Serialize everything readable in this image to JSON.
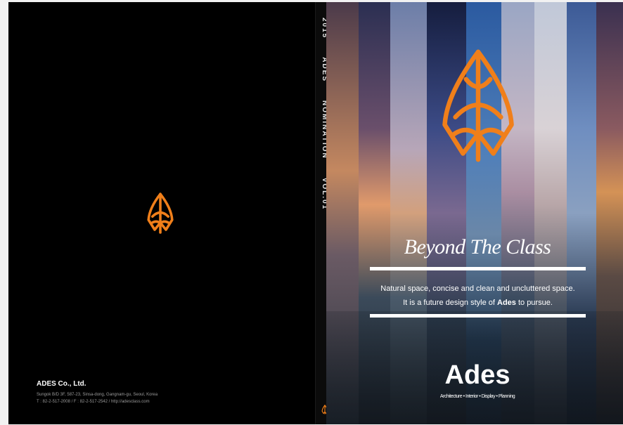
{
  "back_cover": {
    "company": "ADES Co., Ltd.",
    "address_line1": "Sungok B/D 3F, 587-23, Sinsa-dong, Gangnam-gu, Seoul, Korea",
    "address_line2": "T : 82-2-517-2008 / F : 82-2-517-2542 / http://adesclass.com"
  },
  "spine": {
    "year": "2015",
    "brand": "ADES",
    "title": "NOMINATION",
    "volume": "VOL.01"
  },
  "front_cover": {
    "tagline": "Beyond The Class",
    "description_line1": "Natural space, concise and clean and uncluttered space.",
    "description_line2_pre": "It is a future design style of ",
    "description_line2_brand": "Ades",
    "description_line2_post": " to pursue.",
    "brand_name": "Ades",
    "brand_subtitle": "Architecture • Interior • Display • Planning"
  },
  "colors": {
    "logo_orange": "#f07f1a",
    "background": "#000000",
    "text": "#ffffff"
  }
}
